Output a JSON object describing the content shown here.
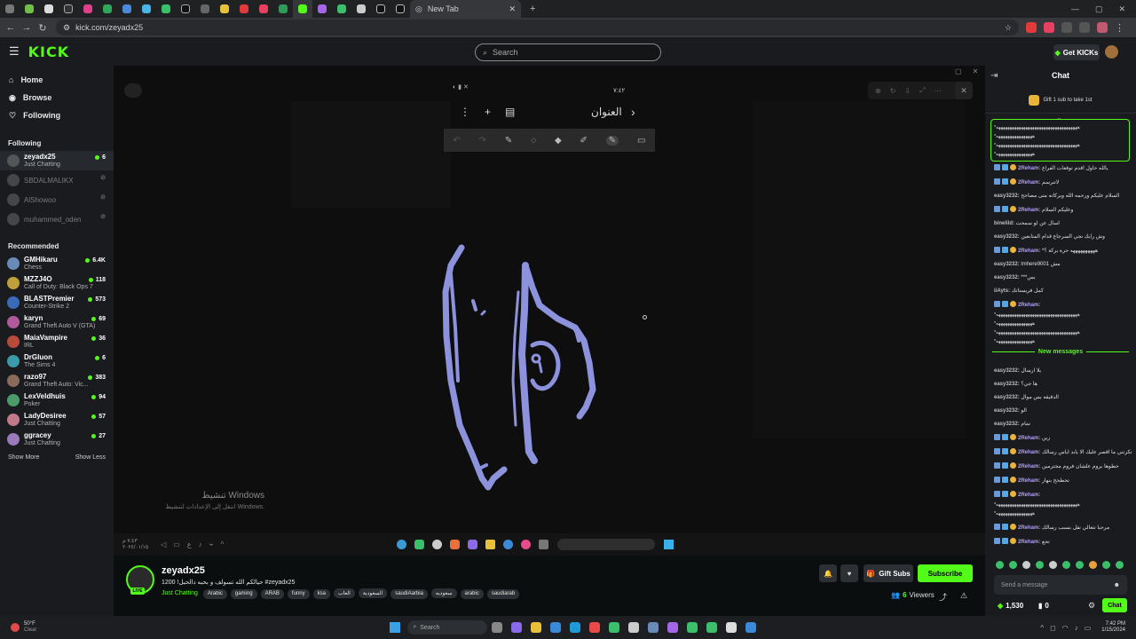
{
  "browser": {
    "new_tab_label": "New Tab",
    "url": "kick.com/zeyadx25"
  },
  "header": {
    "logo": "KICK",
    "search_placeholder": "Search",
    "get_kicks_label": "Get KICKs"
  },
  "sidebar": {
    "nav": [
      {
        "label": "Home",
        "icon": "home-icon"
      },
      {
        "label": "Browse",
        "icon": "compass-icon"
      },
      {
        "label": "Following",
        "icon": "heart-icon"
      }
    ],
    "following_title": "Following",
    "following": [
      {
        "name": "zeyadx25",
        "category": "Just Chatting",
        "viewers": "6",
        "live": true
      },
      {
        "name": "SBDALMALIKX",
        "category": "",
        "viewers": "",
        "live": false
      },
      {
        "name": "AlShowoo",
        "category": "",
        "viewers": "",
        "live": false
      },
      {
        "name": "muhammed_oden",
        "category": "",
        "viewers": "",
        "live": false
      }
    ],
    "recommended_title": "Recommended",
    "recommended": [
      {
        "name": "GMHikaru",
        "category": "Chess",
        "viewers": "6.4K"
      },
      {
        "name": "MZZJ4O",
        "category": "Call of Duty: Black Ops 7",
        "viewers": "118"
      },
      {
        "name": "BLASTPremier",
        "category": "Counter-Strike 2",
        "viewers": "573"
      },
      {
        "name": "karyn",
        "category": "Grand Theft Auto V (GTA)",
        "viewers": "69"
      },
      {
        "name": "MaiaVampire",
        "category": "IRL",
        "viewers": "36"
      },
      {
        "name": "DrGluon",
        "category": "The Sims 4",
        "viewers": "6"
      },
      {
        "name": "razo97",
        "category": "Grand Theft Auto: Vic...",
        "viewers": "383"
      },
      {
        "name": "LexVeldhuis",
        "category": "Poker",
        "viewers": "94"
      },
      {
        "name": "LadyDesiree",
        "category": "Just Chatting",
        "viewers": "57"
      },
      {
        "name": "ggracey",
        "category": "Just Chatting",
        "viewers": "27"
      }
    ],
    "show_more": "Show More",
    "show_less": "Show Less"
  },
  "video": {
    "phone_title": "العنوان",
    "phone_time": "٧:٤٢",
    "activate_title": "تنشيط Windows",
    "activate_sub": "انتقل إلى الإعدادات لتنشيط Windows.",
    "inner_clock": "٧:٤٣ م",
    "inner_date": "٢٠٢٤/٠١/١٥"
  },
  "stream": {
    "channel": "zeyadx25",
    "live_badge": "LIVE",
    "title": "حيالكم الله تسولف و بحبه دالحبل! 1200 #zeyadx25",
    "category": "Just Chatting",
    "tags": [
      "Arabic",
      "gaming",
      "ARAB",
      "funny",
      "ksa",
      "العاب",
      "السعودية",
      "saudiAarbia",
      "سعوديه",
      "arabic",
      "saudiarab"
    ],
    "gift_subs": "Gift Subs",
    "subscribe": "Subscribe",
    "viewers_count": "6",
    "viewers_label": "Viewers"
  },
  "chat": {
    "title": "Chat",
    "gift_banner": "Gift 1 sub to take 1st",
    "pinned_lines": [
      "*ههههههههههههههههههههههههههههههههههههه",
      "*ههههههههههههههههه",
      "*ههههههههههههههههههههههههههههههههههههه",
      "*ههههههههههههههههه"
    ],
    "messages": [
      {
        "user": "2Reham",
        "text": "يالله حاول اقدم توقعات الفراغ",
        "reham": true
      },
      {
        "user": "2Reham",
        "text": "لاتنرسم",
        "reham": true
      },
      {
        "user": "easy3232",
        "text": "السلام عليكم ورحمه الله وبركاته متى مصاحح",
        "reham": false
      },
      {
        "user": "2Reham",
        "text": "وعليكم السلام",
        "reham": true
      },
      {
        "user": "binelild",
        "text": "اسأل عن لو سمحت",
        "reham": false
      },
      {
        "user": "easy3232",
        "text": "وش رايك نجي السرجاع قدام المتابعين",
        "reham": false
      },
      {
        "user": "2Reham",
        "text": "*ههههههههههه حرة بركة ؟",
        "reham": true
      },
      {
        "user": "easy3232",
        "text": "lmhere9001 مش",
        "reham": false
      },
      {
        "user": "easy3232",
        "text": "***بس",
        "reham": false
      },
      {
        "user": "iiAyts",
        "text": "كمل فريستاتك",
        "reham": false
      },
      {
        "user": "2Reham",
        "text": "",
        "reham": true
      }
    ],
    "flood_lines": [
      "*ههههههههههههههههههههههههههههههههههههه",
      "*ههههههههههههههههه",
      "*ههههههههههههههههههههههههههههههههههههه",
      "*ههههههههههههههههه"
    ],
    "new_messages": "New messages",
    "messages2": [
      {
        "user": "easy3232",
        "text": "يلا ارسال",
        "reham": false
      },
      {
        "user": "easy3232",
        "text": "ها جي؟",
        "reham": false
      },
      {
        "user": "easy3232",
        "text": "الدقيقه بس موال",
        "reham": false
      },
      {
        "user": "easy3232",
        "text": "الو",
        "reham": false
      },
      {
        "user": "easy3232",
        "text": "تمام",
        "reham": false
      },
      {
        "user": "2Reham",
        "text": "زين",
        "reham": true
      },
      {
        "user": "2Reham",
        "text": "تكرتني ما اقصر عليك الا يابد اياس رسالك",
        "reham": true
      },
      {
        "user": "2Reham",
        "text": "حطوها بروم علشان فروم مجترمين",
        "reham": true
      },
      {
        "user": "2Reham",
        "text": "تحطحخ بنهار",
        "reham": true
      },
      {
        "user": "2Reham",
        "text": "",
        "reham": true
      }
    ],
    "flood_lines2": [
      "*ههههههههههههههههههههههههههههههههههههه",
      "*ههههههههههههههههه"
    ],
    "messages3": [
      {
        "user": "2Reham",
        "text": "مرحبا تتعالي نقل بسبب رسالك",
        "reham": true
      },
      {
        "user": "2Reham",
        "text": "تحع",
        "reham": true
      }
    ],
    "input_placeholder": "Send a message",
    "kicks_count": "1,530",
    "points_count": "0",
    "chat_button": "Chat"
  },
  "os": {
    "weather_temp": "50°F",
    "weather_desc": "Clear",
    "search_label": "Search",
    "time": "7:42 PM",
    "date": "1/15/2024"
  }
}
